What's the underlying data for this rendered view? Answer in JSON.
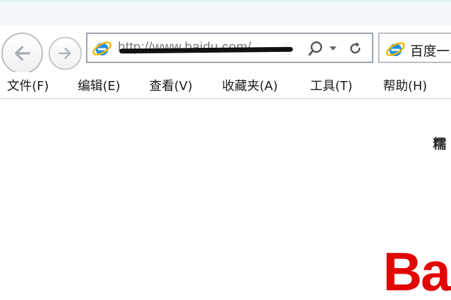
{
  "address_bar": {
    "url": "http://www.baidu.com/"
  },
  "tab": {
    "title": "百度一"
  },
  "menu": [
    {
      "label": "文件(F)"
    },
    {
      "label": "编辑(E)"
    },
    {
      "label": "查看(V)"
    },
    {
      "label": "收藏夹(A)"
    },
    {
      "label": "工具(T)"
    },
    {
      "label": "帮助(H)"
    }
  ],
  "page": {
    "top_link_partial": "糯",
    "logo_partial": "Ba"
  },
  "colors": {
    "ie_blue": "#1f8fe0",
    "ie_ring": "#f2b705",
    "baidu_red": "#e10601"
  },
  "icons": {
    "back": "back-arrow-icon",
    "forward": "forward-arrow-icon",
    "site": "ie-logo-icon",
    "search": "search-icon",
    "dropdown": "chevron-down-icon",
    "refresh": "refresh-icon"
  }
}
